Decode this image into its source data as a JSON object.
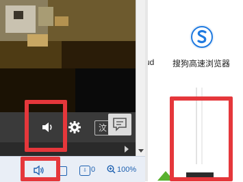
{
  "player": {
    "volume_icon": "speaker-icon",
    "settings_icon": "gear-icon",
    "fullscreen_partial_label": "汶",
    "chat_icon": "comment-icon"
  },
  "status_bar": {
    "volume_icon": "speaker-icon",
    "downloads_count": "0",
    "zoom": "100%"
  },
  "right_panel": {
    "partial_label": "ud",
    "browser_name": "搜狗高速浏览器",
    "browser_icon": "sogou-logo-icon"
  },
  "colors": {
    "annotation": "#e5373b",
    "status_text": "#1b5fb0",
    "browser_logo": "#1f7ae0"
  }
}
